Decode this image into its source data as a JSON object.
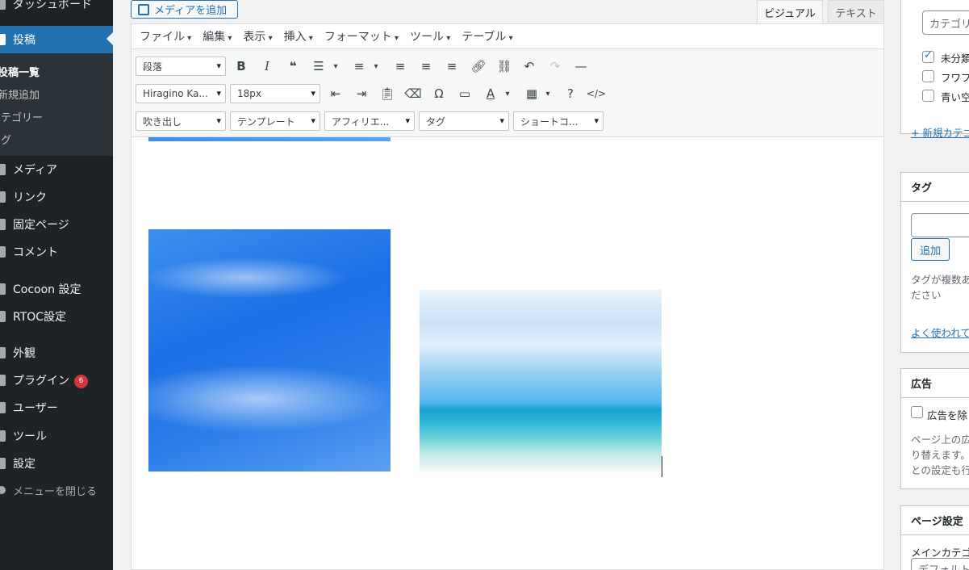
{
  "sidebar": {
    "dashboard": "ダッシュボード",
    "posts": "投稿",
    "posts_sub": [
      "投稿一覧",
      "新規追加",
      "カテゴリー",
      "タグ"
    ],
    "media": "メディア",
    "links": "リンク",
    "pages": "固定ページ",
    "comments": "コメント",
    "cocoon": "Cocoon 設定",
    "rtoc": "RTOC設定",
    "appearance": "外観",
    "plugins": "プラグイン",
    "plugins_badge": "6",
    "users": "ユーザー",
    "tools": "ツール",
    "settings": "設定",
    "collapse": "メニューを閉じる"
  },
  "editor": {
    "add_media": "メディアを追加",
    "tab_visual": "ビジュアル",
    "tab_text": "テキスト",
    "menubar": [
      "ファイル",
      "編集",
      "表示",
      "挿入",
      "フォーマット",
      "ツール",
      "テーブル"
    ],
    "format_select": "段落",
    "font_select": "Hiragino Ka...",
    "size_select": "18px",
    "row3_selects": [
      "吹き出し",
      "テンプレート",
      "アフィリエ...",
      "タグ",
      "ショートコ..."
    ]
  },
  "right": {
    "cat_search_placeholder": "カテゴリー",
    "categories": [
      {
        "label": "未分類",
        "checked": true
      },
      {
        "label": "フワフ",
        "checked": false
      },
      {
        "label": "青い空",
        "checked": false
      }
    ],
    "add_category": "+ 新規カテゴ",
    "tags_title": "タグ",
    "tags_add": "追加",
    "tags_help1": "タグが複数あ",
    "tags_help2": "ださい",
    "tags_link": "よく使われて",
    "ads_title": "広告",
    "ads_checkbox": "広告を除",
    "ads_help1": "ページ上の広",
    "ads_help2": "り替えます。",
    "ads_help3": "との設定も行",
    "page_settings_title": "ページ設定",
    "main_category_label": "メインカテゴ",
    "main_category_value": "デフォルト"
  }
}
